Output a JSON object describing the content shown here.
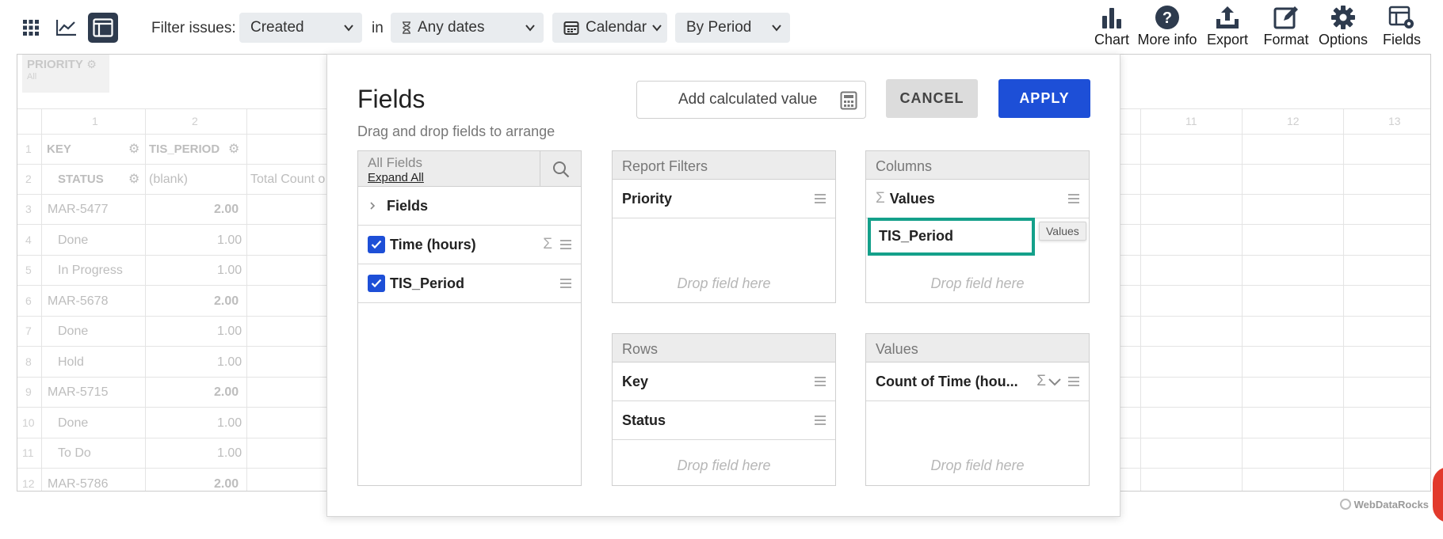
{
  "toolbar": {
    "filter_label": "Filter issues:",
    "filter_value": "Created",
    "in_label": "in",
    "dates_value": "Any dates",
    "calendar_value": "Calendar",
    "period_value": "By Period",
    "tools": [
      {
        "label": "Chart",
        "icon": "bar-chart-icon"
      },
      {
        "label": "More info",
        "icon": "help-icon"
      },
      {
        "label": "Export",
        "icon": "export-icon"
      },
      {
        "label": "Format",
        "icon": "edit-icon"
      },
      {
        "label": "Options",
        "icon": "gear-icon"
      },
      {
        "label": "Fields",
        "icon": "fields-icon"
      }
    ]
  },
  "grid": {
    "filter_chip": "PRIORITY",
    "filter_chip_sub": "All",
    "column_numbers": [
      "1",
      "2",
      "11",
      "12",
      "13"
    ],
    "row_numbers": [
      "1",
      "2",
      "3",
      "4",
      "5",
      "6",
      "7",
      "8",
      "9",
      "10",
      "11",
      "12"
    ],
    "header_key": "KEY",
    "header_period": "TIS_PERIOD",
    "header_status": "STATUS",
    "blank_label": "(blank)",
    "total_label": "Total Count o",
    "rows": [
      {
        "label": "MAR-5477",
        "value": "2.00",
        "group": true
      },
      {
        "label": "Done",
        "value": "1.00",
        "group": false
      },
      {
        "label": "In Progress",
        "value": "1.00",
        "group": false
      },
      {
        "label": "MAR-5678",
        "value": "2.00",
        "group": true
      },
      {
        "label": "Done",
        "value": "1.00",
        "group": false
      },
      {
        "label": "Hold",
        "value": "1.00",
        "group": false
      },
      {
        "label": "MAR-5715",
        "value": "2.00",
        "group": true
      },
      {
        "label": "Done",
        "value": "1.00",
        "group": false
      },
      {
        "label": "To Do",
        "value": "1.00",
        "group": false
      },
      {
        "label": "MAR-5786",
        "value": "2.00",
        "group": true
      }
    ],
    "watermark": "WebDataRocks"
  },
  "modal": {
    "title": "Fields",
    "subtitle": "Drag and drop fields to arrange",
    "calc_button": "Add calculated value",
    "cancel_button": "CANCEL",
    "apply_button": "APPLY",
    "all_fields": {
      "title": "All Fields",
      "expand_all": "Expand All",
      "group": "Fields",
      "items": [
        {
          "label": "Time (hours)",
          "checked": true
        },
        {
          "label": "TIS_Period",
          "checked": true
        }
      ]
    },
    "report_filters": {
      "title": "Report Filters",
      "items": [
        "Priority"
      ],
      "drop": "Drop field here"
    },
    "columns": {
      "title": "Columns",
      "items": [
        "Values"
      ],
      "dragging": "TIS_Period",
      "tooltip": "Values",
      "drop": "Drop field here"
    },
    "rows": {
      "title": "Rows",
      "items": [
        "Key",
        "Status"
      ],
      "drop": "Drop field here"
    },
    "values": {
      "title": "Values",
      "items": [
        "Count of Time (hou..."
      ],
      "drop": "Drop field here"
    }
  },
  "colors": {
    "accent": "#1d4fd7",
    "highlight": "#14a08a",
    "toolbar_dark": "#2e3b4e"
  }
}
